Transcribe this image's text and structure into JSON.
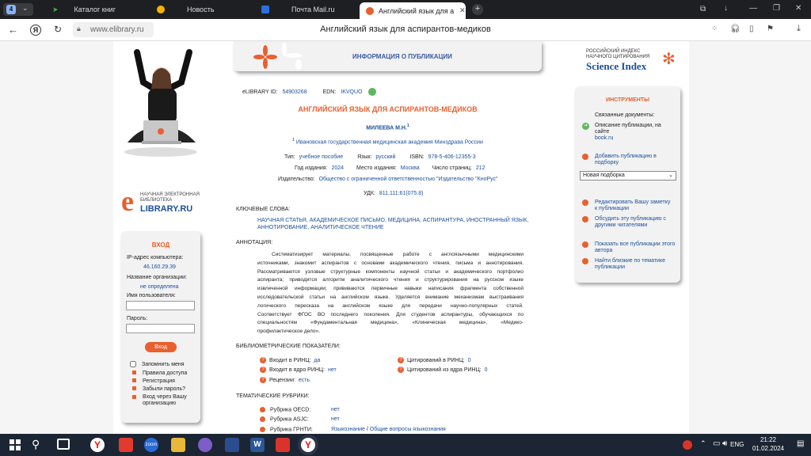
{
  "browser": {
    "tab_count": "4",
    "tabs": [
      {
        "label": "Каталог книг"
      },
      {
        "label": "Новость"
      },
      {
        "label": "Почта Mail.ru"
      },
      {
        "label": "Английский язык для а"
      }
    ],
    "url": "www.elibrary.ru",
    "page_title": "Английский язык для аспирантов-медиков"
  },
  "left": {
    "logo_small": "НАУЧНАЯ ЭЛЕКТРОННАЯ БИБЛИОТЕКА",
    "logo_big": "LIBRARY.RU",
    "login": {
      "title": "ВХОД",
      "ip_label": "IP-адрес компьютера:",
      "ip_value": "46.160.29.39",
      "org_label": "Название организации:",
      "org_value": "не определена",
      "user_label": "Имя пользователя:",
      "pass_label": "Пароль:",
      "login_button": "Вход",
      "remember": "Запомнить меня",
      "links": [
        "Правила доступа",
        "Регистрация",
        "Забыли пароль?",
        "Вход через Вашу организацию"
      ]
    }
  },
  "header": {
    "info_title": "ИНФОРМАЦИЯ О ПУБЛИКАЦИИ"
  },
  "pub": {
    "id_label": "eLIBRARY ID:",
    "id_value": "54903268",
    "edn_label": "EDN:",
    "edn_value": "IKVQUO",
    "title": "АНГЛИЙСКИЙ ЯЗЫК ДЛЯ АСПИРАНТОВ-МЕДИКОВ",
    "author": "МИЛЕЕВА М.Н.",
    "author_sup": "1",
    "aff_sup": "1",
    "affiliation": "Ивановская государственная медицинская академия Минздрава России",
    "type_label": "Тип:",
    "type_value": "учебное пособие",
    "lang_label": "Язык:",
    "lang_value": "русский",
    "isbn_label": "ISBN:",
    "isbn_value": "978-5-406-12355-3",
    "year_label": "Год издания:",
    "year_value": "2024",
    "place_label": "Место издания:",
    "place_value": "Москва",
    "pages_label": "Число страниц:",
    "pages_value": "212",
    "publisher_label": "Издательство:",
    "publisher_value": "Общество с ограниченной ответственностью \"Издательство \"КноРус\"",
    "udk_label": "УДК:",
    "udk_value": "811.111:61(075.8)",
    "keywords_title": "КЛЮЧЕВЫЕ СЛОВА:",
    "keywords_line1": "НАУЧНАЯ СТАТЬЯ, АКАДЕМИЧЕСКОЕ ПИСЬМО, МЕДИЦИНА, АСПИРАНТУРА, ИНОСТРАННЫЙ ЯЗЫК,",
    "keywords_line2": "АННОТИРОВАНИЕ, АНАЛИТИЧЕСКОЕ ЧТЕНИЕ",
    "annotation_title": "АННОТАЦИЯ:",
    "annotation": [
      "Систематизирует материалы, посвященные работе с англоязычными медицинскими",
      "источниками, знакомит аспирантов с основами академического чтения, письма и аннотирования.",
      "Рассматриваются узловые структурные компоненты научной статьи и академического портфолио",
      "аспиранта; приводится алгоритм аналитического чтения и структурирования на русском языке",
      "извлеченной информации; прививаются первичные навыки написания фрагмента собственной",
      "исследовательской статьи на английском языке. Уделяется внимание механизмам выстраивания",
      "логического пересказа на английском языке для передачи научно-популярных статей.",
      "Соответствует ФГОС ВО последнего поколения. Для студентов аспирантуры, обучающихся по",
      "специальностям «Фундаментальная медицина», «Клиническая медицина», «Медико-",
      "профилактическое дело»."
    ],
    "biblio_title": "БИБЛИОМЕТРИЧЕСКИЕ ПОКАЗАТЕЛИ:",
    "rinc_label": "Входит в РИНЦ:",
    "rinc_value": "да",
    "core_label": "Входит в ядро РИНЦ:",
    "core_value": "нет",
    "reviews_label": "Рецензии:",
    "reviews_value": "есть",
    "cit_rinc_label": "Цитирований в РИНЦ:",
    "cit_rinc_value": "0",
    "cit_core_label": "Цитирований из ядра РИНЦ:",
    "cit_core_value": "0",
    "rubrics_title": "ТЕМАТИЧЕСКИЕ РУБРИКИ:",
    "oecd_label": "Рубрика OECD:",
    "oecd_value": "нет",
    "asjc_label": "Рубрика ASJC:",
    "asjc_value": "нет",
    "grnti_label": "Рубрика ГРНТИ:",
    "grnti_value1": "Языкознание",
    "grnti_sep": "/",
    "grnti_value2": "Общие вопросы языкознания"
  },
  "right": {
    "si_line1": "РОССИЙСКИЙ ИНДЕКС",
    "si_line2": "НАУЧНОГО ЦИТИРОВАНИЯ",
    "si_brand": "Science Index",
    "tools_title": "ИНСТРУМЕНТЫ",
    "related_label": "Связанные документы:",
    "desc_link": "Описание публикации, на сайте",
    "desc_site": "book.ru",
    "add_link": "Добавить публикацию в подборку",
    "select_value": "Новая подборка",
    "edit_link": "Редактировать Вашу заметку к публикации",
    "discuss_link": "Обсудить эту публикацию с другими читателями",
    "author_link": "Показать все публикации этого автора",
    "similar_link": "Найти близкие по тематике публикации"
  },
  "taskbar": {
    "lang": "ENG",
    "time": "21:22",
    "date": "01.02.2024"
  },
  "colors": {
    "accent": "#e95f2e",
    "link": "#1a4f9a",
    "header_blue": "#3b5aa6"
  }
}
